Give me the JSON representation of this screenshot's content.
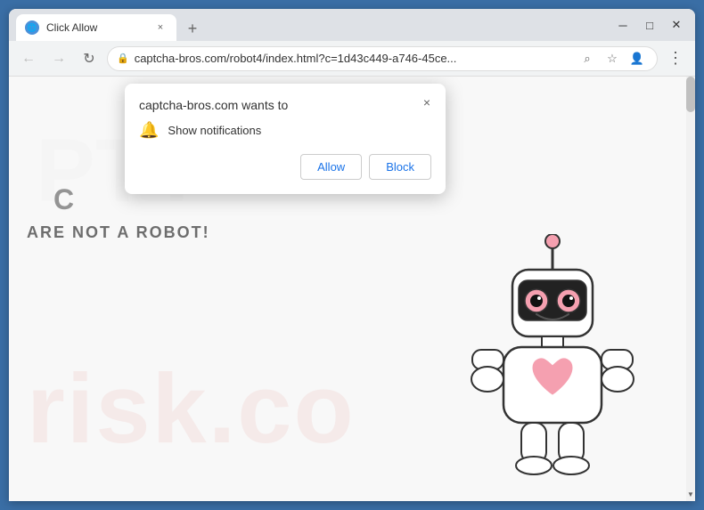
{
  "window": {
    "title": "Click Allow",
    "favicon": "🌐",
    "tab_close": "×",
    "new_tab": "+",
    "controls": {
      "minimize": "─",
      "maximize": "□",
      "close": "✕"
    }
  },
  "addressbar": {
    "back": "←",
    "forward": "→",
    "refresh": "↻",
    "url": "captcha-bros.com/robot4/index.html?c=1d43c449-a746-45ce...",
    "lock": "🔒",
    "search_icon": "⌕",
    "bookmark": "☆",
    "account": "👤",
    "menu": "⋮"
  },
  "page": {
    "captcha_partial": "C",
    "not_robot": "ARE NOT A ROBOT!",
    "watermark": "risk.co",
    "watermark_logo": "PTT"
  },
  "notification": {
    "title": "captcha-bros.com wants to",
    "bell_icon": "🔔",
    "description": "Show notifications",
    "close": "×",
    "allow_label": "Allow",
    "block_label": "Block"
  },
  "scrollbar": {
    "up_arrow": "▲",
    "down_arrow": "▼"
  }
}
